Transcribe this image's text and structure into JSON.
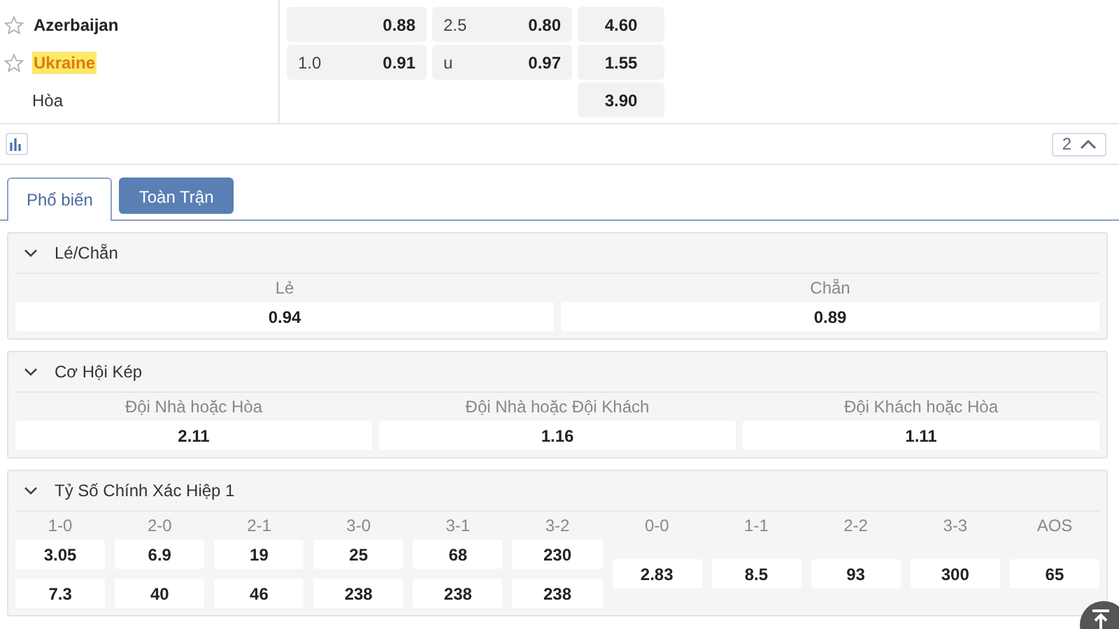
{
  "match": {
    "teams": [
      {
        "name": "Azerbaijan",
        "favorite": false,
        "highlighted": false,
        "handicap_odds": "0.88",
        "total_line": "2.5",
        "total_odds": "0.80",
        "moneyline": "4.60"
      },
      {
        "name": "Ukraine",
        "favorite": false,
        "highlighted": true,
        "handicap_line": "1.0",
        "handicap_odds": "0.91",
        "total_line": "u",
        "total_odds": "0.97",
        "moneyline": "1.55"
      }
    ],
    "draw": {
      "label": "Hòa",
      "moneyline": "3.90"
    }
  },
  "toolbar": {
    "count": "2"
  },
  "tabs": [
    {
      "label": "Phổ biến",
      "selected": true
    },
    {
      "label": "Toàn Trận",
      "selected": false
    }
  ],
  "markets": [
    {
      "kind": "simple",
      "title": "Lé/Chẵn",
      "expanded": true,
      "selections": [
        {
          "label": "Lẻ",
          "odds": "0.94"
        },
        {
          "label": "Chẵn",
          "odds": "0.89"
        }
      ]
    },
    {
      "kind": "simple",
      "title": "Cơ Hội Kép",
      "expanded": true,
      "selections": [
        {
          "label": "Đội Nhà hoặc Hòa",
          "odds": "2.11"
        },
        {
          "label": "Đội Nhà hoặc Đội Khách",
          "odds": "1.16"
        },
        {
          "label": "Đội Khách hoặc Hòa",
          "odds": "1.11"
        }
      ]
    },
    {
      "kind": "score",
      "title": "Tỷ Số Chính Xác Hiệp 1",
      "expanded": true,
      "columns": [
        {
          "label": "1-0",
          "odds": [
            "3.05",
            "7.3"
          ]
        },
        {
          "label": "2-0",
          "odds": [
            "6.9",
            "40"
          ]
        },
        {
          "label": "2-1",
          "odds": [
            "19",
            "46"
          ]
        },
        {
          "label": "3-0",
          "odds": [
            "25",
            "238"
          ]
        },
        {
          "label": "3-1",
          "odds": [
            "68",
            "238"
          ]
        },
        {
          "label": "3-2",
          "odds": [
            "230",
            "238"
          ]
        },
        {
          "label": "0-0",
          "odds": [
            "2.83"
          ]
        },
        {
          "label": "1-1",
          "odds": [
            "8.5"
          ]
        },
        {
          "label": "2-2",
          "odds": [
            "93"
          ]
        },
        {
          "label": "3-3",
          "odds": [
            "300"
          ]
        },
        {
          "label": "AOS",
          "odds": [
            "65"
          ]
        }
      ]
    }
  ]
}
